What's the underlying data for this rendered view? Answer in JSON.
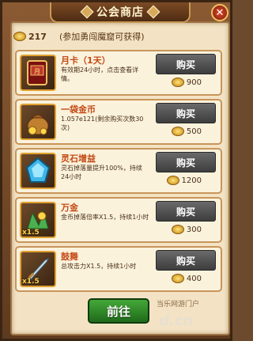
{
  "window": {
    "title": "公会商店",
    "close_glyph": "✕"
  },
  "header": {
    "points": "217",
    "hint": "(参加勇闯魔窟可获得)"
  },
  "items": [
    {
      "name": "月卡（1天）",
      "desc": "有效期24小时，点击查看详情。",
      "buy_label": "购买",
      "price": "900",
      "badge": ""
    },
    {
      "name": "一袋金币",
      "desc": "1.057e121(剩余购买次数30次)",
      "buy_label": "购买",
      "price": "500",
      "badge": ""
    },
    {
      "name": "灵石增益",
      "desc": "灵石掉落量提升100%，持续24小时",
      "buy_label": "购买",
      "price": "1200",
      "badge": ""
    },
    {
      "name": "万金",
      "desc": "金币掉落倍率X1.5，持续1小时",
      "buy_label": "购买",
      "price": "300",
      "badge": "x1.5"
    },
    {
      "name": "鼓舞",
      "desc": "总攻击力X1.5，持续1小时",
      "buy_label": "购买",
      "price": "400",
      "badge": "x1.5"
    }
  ],
  "footer": {
    "go_label": "前往",
    "watermark": "当乐网游门户",
    "watermark_domain": "d.cn"
  },
  "colors": {
    "accent": "#c44a16",
    "buy_button": "#4d4d4d",
    "go_button": "#2f8a28"
  }
}
